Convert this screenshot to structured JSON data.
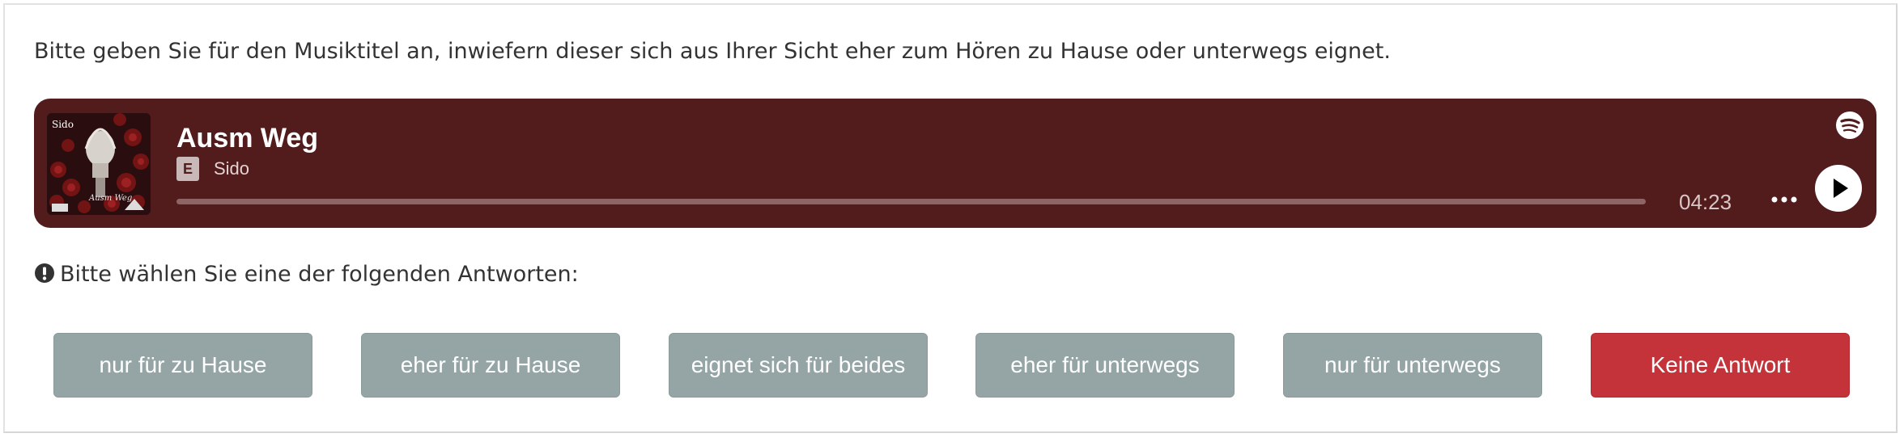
{
  "question": "Bitte geben Sie für den Musiktitel an, inwiefern dieser sich aus Ihrer Sicht eher zum Hören zu Hause oder unterwegs eignet.",
  "player": {
    "track_title": "Ausm Weg",
    "explicit_badge": "E",
    "artist": "Sido",
    "duration": "04:23",
    "progress": 0,
    "background_color": "#531c1c",
    "service_icon": "spotify-icon",
    "play_icon": "play-icon",
    "more_icon": "more-options-icon"
  },
  "prompt": {
    "icon": "exclamation-circle-icon",
    "text": "Bitte wählen Sie eine der folgenden Antworten:"
  },
  "answers": [
    {
      "label": "nur für zu Hause"
    },
    {
      "label": "eher für zu Hause"
    },
    {
      "label": "eignet sich für beides"
    },
    {
      "label": "eher für unterwegs"
    },
    {
      "label": "nur für unterwegs"
    },
    {
      "label": "Keine Antwort"
    }
  ],
  "colors": {
    "answer_button": "#95a5a6",
    "no_answer_button": "#c4333a"
  }
}
